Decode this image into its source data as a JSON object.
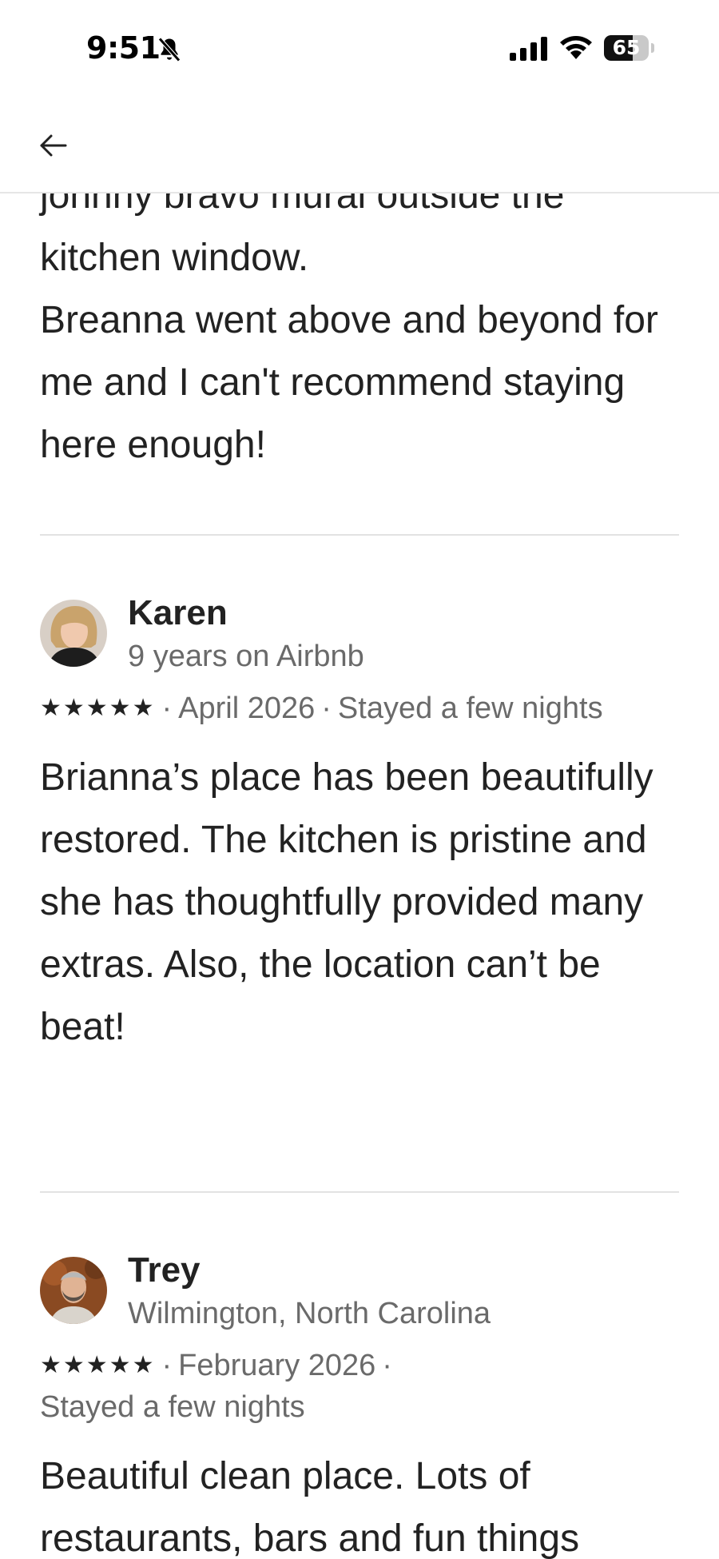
{
  "status_bar": {
    "time": "9:51",
    "battery": "65",
    "battery_level": 0.65
  },
  "nav": {
    "back_icon": "arrow-left-icon"
  },
  "reviews": [
    {
      "text_partial": "johnny bravo mural outside the kitchen window.\nBreanna went above and beyond for me and I can't recommend staying here enough!"
    },
    {
      "name": "Karen",
      "subtitle": "9 years on Airbnb",
      "stars": "★★★★★",
      "rating": 5,
      "date": "April 2026",
      "stay": "Stayed a few nights",
      "text": "Brianna’s place has been beautifully restored. The kitchen is pristine and she has thoughtfully provided many extras. Also, the location can’t be beat!"
    },
    {
      "name": "Trey",
      "subtitle": "Wilmington, North Carolina",
      "stars": "★★★★★",
      "rating": 5,
      "date": "February 2026",
      "stay": "Stayed a few nights",
      "text": "Beautiful clean place. Lots of restaurants, bars and fun things"
    }
  ],
  "separator": "·"
}
